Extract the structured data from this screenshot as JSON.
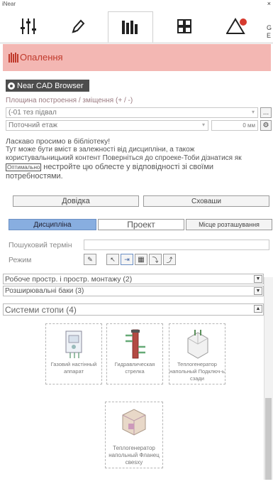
{
  "window": {
    "title": "iNear",
    "close": "×"
  },
  "tabs": [
    {
      "name": "sliders"
    },
    {
      "name": "pencil"
    },
    {
      "name": "library"
    },
    {
      "name": "grid"
    },
    {
      "name": "warning"
    }
  ],
  "tab_extra": {
    "line1": "G",
    "line2": "E"
  },
  "header": {
    "title": "Опалення"
  },
  "browser": {
    "title": "Near CAD Browser",
    "placement_label": "Площина построення / зміщення (+ / -)",
    "placement_value": "(-01 тез підвал",
    "current_floor": "Поточний етаж",
    "offset_value": "0 мм",
    "ellipsis": "..."
  },
  "welcome": {
    "line1": "Ласкаво просимо в бібліотеку!",
    "line2": "Тут може бути вміст в залежності від дисципліни, а також",
    "line3a": "користувальницький контент",
    "line3b": "Поверніться до спроеке-Тоби дізнатися",
    "line3c": "як",
    "line4a": "Оптимально",
    "line4b": "нестройте цю облесте у відповідності зі своїми",
    "line5": "потребностями.",
    "help_button": "Довідка",
    "hide_button": "Сховаши"
  },
  "filter_tabs": {
    "discipline": "Дисципліна",
    "project": "Проект",
    "location": "Місце розташування"
  },
  "search": {
    "label": "Пошуковий термін",
    "value": ""
  },
  "mode": {
    "label": "Режим"
  },
  "sections": {
    "workspace": "Робоче простр. і простр. монтажу (2)",
    "expansion": "Розширювальні баки (3)",
    "systems": "Системи стопи (4)"
  },
  "items": [
    {
      "caption": "Газовий настінный аппарат"
    },
    {
      "caption": "Гидравлическая стрелка"
    },
    {
      "caption": "Теплогенератор напольный Подключ-ь сзади"
    },
    {
      "caption": "Теплогенератор напольный Фланец свеsху"
    }
  ],
  "colors": {
    "accent": "#c0392b",
    "header_bg": "#f3b7b3",
    "tab_active": "#88aee0"
  }
}
